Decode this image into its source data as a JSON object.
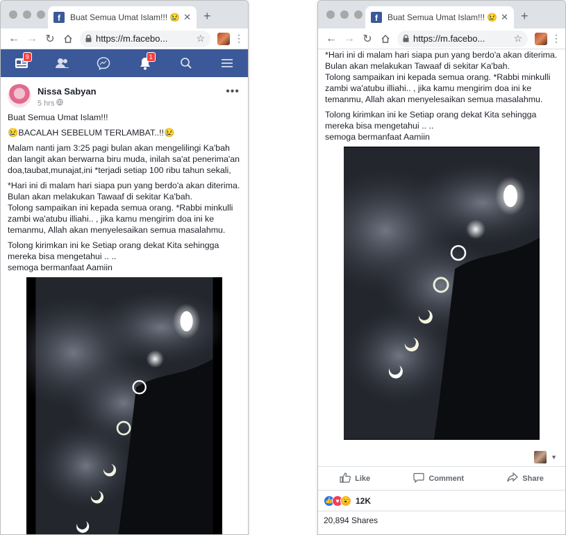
{
  "browser": {
    "tab_title": "Buat Semua Umat Islam!!! 😢B",
    "url": "https://m.facebo..."
  },
  "fb_nav": {
    "home_badge": "9",
    "notif_badge": "1"
  },
  "post": {
    "author": "Nissa Sabyan",
    "time": "5 hrs",
    "p1": "Buat Semua Umat Islam!!!",
    "p2": "😢BACALAH SEBELUM TERLAMBAT..!!😢",
    "p3": "Malam nanti jam 3:25 pagi bulan akan mengelilingi Ka'bah dan langit akan berwarna biru muda, inilah sa'at penerima'an doa,taubat,munajat,ini *terjadi setiap 100 ribu tahun sekali,",
    "p4": "*Hari ini di malam hari siapa pun yang berdo'a akan diterima. Bulan akan melakukan Tawaaf di sekitar Ka'bah.\nTolong sampaikan ini kepada semua orang. *Rabbi minkulli zambi wa'atubu illiahi.. , jika kamu mengirim doa ini ke temanmu, Allah akan menyelesaikan semua masalahmu.",
    "p5": "Tolong kirimkan ini ke Setiap orang dekat Kita sehingga mereka bisa mengetahui .. ..\nsemoga bermanfaat Aamiin"
  },
  "actions": {
    "like": "Like",
    "comment": "Comment",
    "share": "Share"
  },
  "stats": {
    "reactions": "12K",
    "shares": "20,894 Shares"
  },
  "colors": {
    "fb_blue": "#3b5998",
    "badge_red": "#fa3e3e"
  }
}
